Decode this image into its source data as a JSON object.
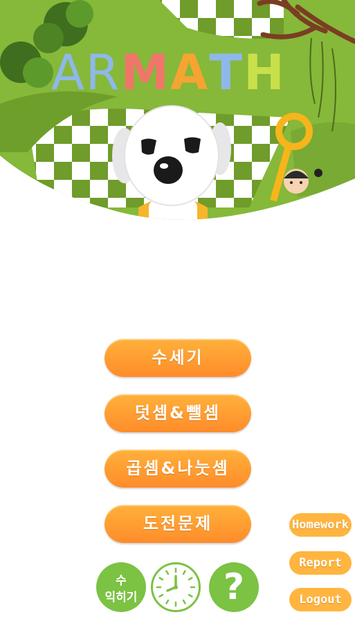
{
  "logo": {
    "letters": [
      "A",
      "R",
      "M",
      "A",
      "T",
      "H"
    ],
    "colors": [
      "#8fb8ea",
      "#8fb8ea",
      "#f0766a",
      "#f5a431",
      "#8fb8ea",
      "#c8e04a"
    ]
  },
  "menu": {
    "counting": "수세기",
    "add_subtract": "덧셈&뺄셈",
    "multiply_divide": "곱셈&나눗셈",
    "challenge": "도전문제"
  },
  "side_buttons": {
    "homework": "Homework",
    "report": "Report",
    "logout": "Logout"
  },
  "bottom": {
    "practice_line1": "수",
    "practice_line2": "익히기",
    "help": "?",
    "clock_icon": "clock-icon"
  },
  "colors": {
    "accent_orange": "#ff9a2e",
    "accent_green": "#7cc243",
    "grass_green": "#7fae32"
  }
}
